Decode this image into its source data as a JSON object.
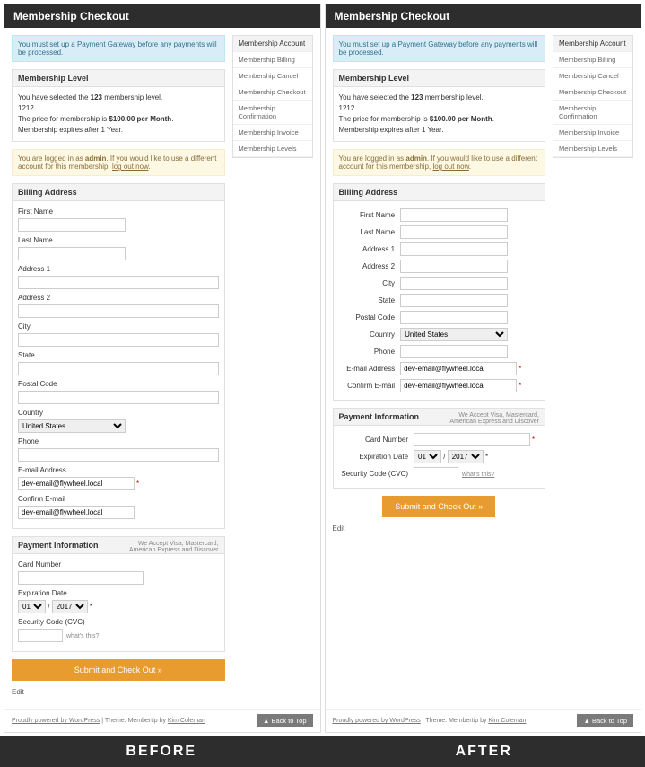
{
  "page_title": "Membership Checkout",
  "gateway_alert_pre": "You must ",
  "gateway_alert_link": "set up a Payment Gateway",
  "gateway_alert_post": " before any payments will be processed.",
  "level": {
    "heading": "Membership Level",
    "line1_pre": "You have selected the ",
    "line1_level": "123",
    "line1_post": " membership level.",
    "line2": "1212",
    "line3_pre": "The price for membership is ",
    "line3_price": "$100.00 per Month",
    "line3_post": ".",
    "line4": "Membership expires after 1 Year."
  },
  "login_alert_pre": "You are logged in as ",
  "login_alert_user": "admin",
  "login_alert_mid": ". If you would like to use a different account for this membership, ",
  "login_alert_link": "log out now",
  "login_alert_post": ".",
  "billing": {
    "heading": "Billing Address",
    "first_name": "First Name",
    "last_name": "Last Name",
    "address1": "Address 1",
    "address2": "Address 2",
    "city": "City",
    "state": "State",
    "postal": "Postal Code",
    "country": "Country",
    "country_value": "United States",
    "phone": "Phone",
    "email": "E-mail Address",
    "email_value": "dev-email@flywheel.local",
    "confirm_email": "Confirm E-mail",
    "confirm_email_value": "dev-email@flywheel.local"
  },
  "payment": {
    "heading": "Payment Information",
    "note": "We Accept Visa, Mastercard, American Express and Discover",
    "card_number": "Card Number",
    "exp_date": "Expiration Date",
    "exp_mm": "01",
    "exp_yy": "2017",
    "cvc": "Security Code (CVC)",
    "whats": "what's this?"
  },
  "submit": "Submit and Check Out »",
  "edit": "Edit",
  "sidebar": {
    "heading": "Membership Account",
    "items": [
      "Membership Billing",
      "Membership Cancel",
      "Membership Checkout",
      "Membership Confirmation",
      "Membership Invoice",
      "Membership Levels"
    ]
  },
  "footer_pre": "Proudly powered by WordPress",
  "footer_sep": " | Theme: Membertip by ",
  "footer_author": "Kim Coleman",
  "back_to_top": "▲ Back to Top",
  "labels": {
    "before": "BEFORE",
    "after": "AFTER"
  }
}
